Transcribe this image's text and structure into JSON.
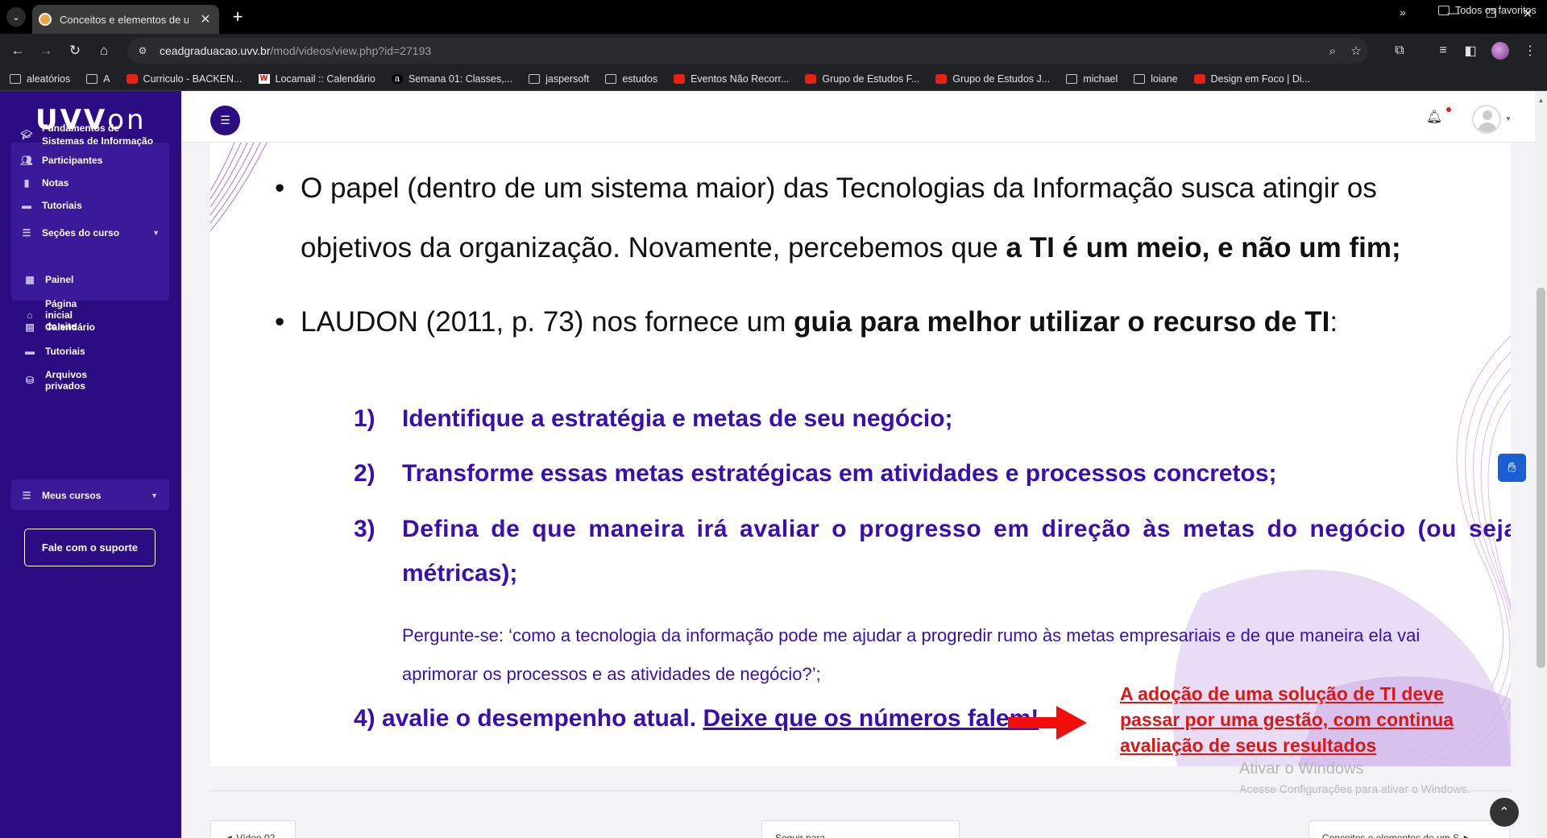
{
  "browser": {
    "tab_title": "Conceitos e elementos de um S",
    "url_host": "ceadgraduacao.uvv.br",
    "url_path": "/mod/videos/view.php?id=27193",
    "bookmarks": [
      {
        "label": "aleatórios",
        "icon": "folder-icon"
      },
      {
        "label": "A",
        "icon": "folder-icon"
      },
      {
        "label": "Curriculo - BACKEN...",
        "icon": "youtube-icon"
      },
      {
        "label": "Locamail :: Calendário",
        "icon": "locaweb-icon"
      },
      {
        "label": "Semana 01: Classes,...",
        "icon": "a-icon"
      },
      {
        "label": "jaspersoft",
        "icon": "folder-icon"
      },
      {
        "label": "estudos",
        "icon": "folder-icon"
      },
      {
        "label": "Eventos Não Recorr...",
        "icon": "youtube-icon"
      },
      {
        "label": "Grupo de Estudos F...",
        "icon": "youtube-icon"
      },
      {
        "label": "Grupo de Estudos J...",
        "icon": "youtube-icon"
      },
      {
        "label": "michael",
        "icon": "folder-icon"
      },
      {
        "label": "loiane",
        "icon": "folder-icon"
      },
      {
        "label": "Design em Foco | Di...",
        "icon": "youtube-icon"
      }
    ],
    "all_bookmarks": "Todos os favoritos"
  },
  "sidebar": {
    "brand_main": "UVV",
    "brand_on": "on",
    "course_items": [
      {
        "label": "Fundamentos de Sistemas de Informação",
        "icon": "graduation-cap-icon"
      },
      {
        "label": "Participantes",
        "icon": "users-icon"
      },
      {
        "label": "Notas",
        "icon": "book-icon"
      },
      {
        "label": "Tutoriais",
        "icon": "folder-icon"
      },
      {
        "label": "Seções do curso",
        "icon": "list-icon"
      }
    ],
    "nav_items": [
      {
        "label": "Painel",
        "icon": "dashboard-icon"
      },
      {
        "label": "Página inicial do site",
        "icon": "home-icon"
      },
      {
        "label": "Calendário",
        "icon": "calendar-icon"
      },
      {
        "label": "Tutoriais",
        "icon": "folder-icon"
      },
      {
        "label": "Arquivos privados",
        "icon": "drive-icon"
      }
    ],
    "my_courses": "Meus cursos",
    "support": "Fale com o suporte"
  },
  "slide": {
    "bullet1_line1": "O papel (dentro de um sistema maior) das Tecnologias da Informação  susca atingir os",
    "bullet1_line2_plain": "objetivos da organização. Novamente, percebemos que ",
    "bullet1_line2_bold": "a TI é um meio, e não um fim;",
    "bullet2_plain": "LAUDON (2011, p. 73) nos fornece um ",
    "bullet2_bold": "guia para melhor utilizar o recurso de TI",
    "bullet2_end": ":",
    "steps": [
      {
        "num": "1)",
        "text": "Identifique a estratégia e metas de seu negócio;"
      },
      {
        "num": "2)",
        "text": "Transforme essas metas estratégicas em atividades e processos concretos;"
      },
      {
        "num": "3)",
        "text": "Defina de que maneira irá avaliar o progresso em direção às metas do negócio (ou seja, as"
      }
    ],
    "step3_cont": "métricas);",
    "question": "Pergunte-se: ‘como a tecnologia da informação pode me ajudar a progredir rumo às metas empresariais e de que maneira ela vai aprimorar os processos e as atividades de negócio?’;",
    "step4_plain": "4) avalie o desempenho atual. ",
    "step4_underlined": "Deixe que os números falem!",
    "red_note": "A adoção de uma solução de TI deve passar por uma gestão, com continua avaliação de seus resultados"
  },
  "windows_watermark": {
    "title": "Ativar o Windows",
    "subtitle": "Acesse Configurações para ativar o Windows."
  },
  "bottom": {
    "prev": "◄ Vídeo 02",
    "jump": "Seguir para...",
    "next": "Conceitos e elementos de um S ►"
  },
  "colors": {
    "sidebar_bg": "#2b0c82",
    "step_text": "#3a0fb0",
    "red_note": "#e01515"
  }
}
